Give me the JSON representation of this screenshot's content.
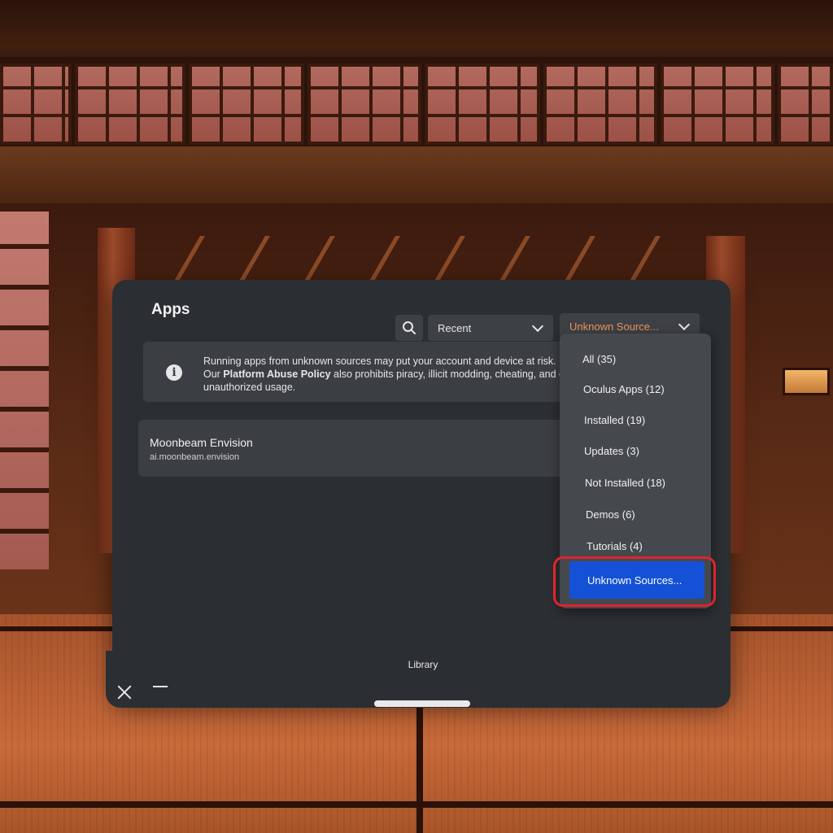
{
  "panel": {
    "title": "Apps",
    "footer_label": "Library"
  },
  "toolbar": {
    "search_icon": "search-icon",
    "sort_value": "Recent",
    "filter_value": "Unknown Source..."
  },
  "notice": {
    "icon": "info-icon",
    "line1": "Running apps from unknown sources may put your account and device at risk.",
    "line2_prefix": "Our ",
    "line2_link": "Platform Abuse Policy",
    "line2_suffix": " also prohibits piracy, illicit modding, cheating, and oth",
    "line3": "unauthorized usage."
  },
  "apps": [
    {
      "name": "Moonbeam Envision",
      "package": "ai.moonbeam.envision"
    }
  ],
  "filter_menu": {
    "items": [
      "All (35)",
      "Oculus Apps (12)",
      "Installed (19)",
      "Updates (3)",
      "Not Installed (18)",
      "Demos (6)",
      "Tutorials (4)"
    ],
    "selected": "Unknown Sources..."
  },
  "colors": {
    "panel": "#2b2e32",
    "accent_blue": "#1451d6",
    "filter_text": "#f0955a",
    "highlight_red": "#e2232b"
  }
}
